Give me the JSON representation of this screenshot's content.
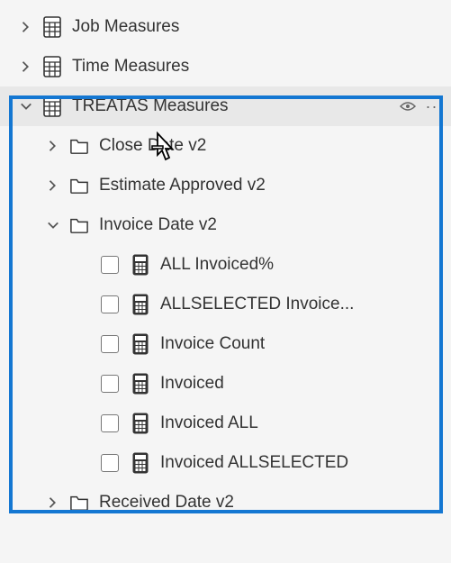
{
  "tree": {
    "job_measures": "Job Measures",
    "time_measures": "Time Measures",
    "treatas_measures": "TREATAS Measures",
    "close_date_v2": "Close Date v2",
    "estimate_approved_v2": "Estimate Approved v2",
    "invoice_date_v2": "Invoice Date v2",
    "received_date_v2": "Received Date v2",
    "measures": {
      "all_invoiced_pct": "ALL Invoiced%",
      "allselected_invoice": "ALLSELECTED Invoice...",
      "invoice_count": "Invoice Count",
      "invoiced": "Invoiced",
      "invoiced_all": "Invoiced ALL",
      "invoiced_allselected": "Invoiced ALLSELECTED"
    }
  }
}
